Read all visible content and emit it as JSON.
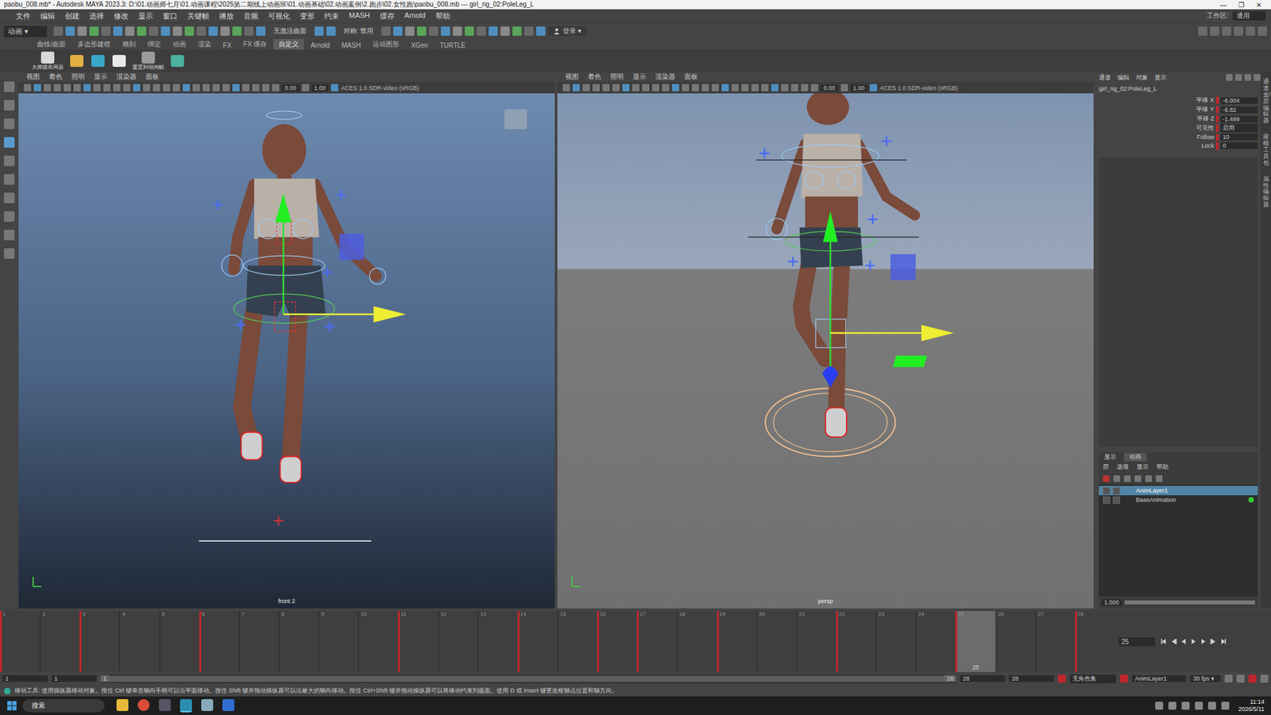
{
  "window": {
    "title": "paobu_008.mb* - Autodesk MAYA 2023.3: D:\\01.动画师七月\\01.动画课程\\2025第二期线上动画班\\01.动画基础\\02.动画案例\\2.跑步\\02.女性跑\\paobu_008.mb  ---  girl_rig_02:PoleLeg_L",
    "controls": [
      "—",
      "❐",
      "✕"
    ]
  },
  "menu": [
    "文件",
    "编辑",
    "创建",
    "选择",
    "修改",
    "显示",
    "窗口",
    "关键帧",
    "播放",
    "音频",
    "可视化",
    "变形",
    "约束",
    "MASH",
    "缓存",
    "Arnold",
    "帮助"
  ],
  "workspace": {
    "label": "工作区:",
    "value": "通用"
  },
  "status_line": {
    "mode": "动画",
    "live_surface": "无激活曲面",
    "symmetry": "对称: 禁用",
    "login": "登录"
  },
  "shelf_tabs": [
    {
      "label": "曲线/曲面",
      "selected": false
    },
    {
      "label": "多边形建模",
      "selected": false
    },
    {
      "label": "雕刻",
      "selected": false
    },
    {
      "label": "绑定",
      "selected": false
    },
    {
      "label": "动画",
      "selected": false
    },
    {
      "label": "渲染",
      "selected": false
    },
    {
      "label": "FX",
      "selected": false
    },
    {
      "label": "FX 缓存",
      "selected": false
    },
    {
      "label": "自定义",
      "selected": true
    },
    {
      "label": "Arnold",
      "selected": false
    },
    {
      "label": "MASH",
      "selected": false
    },
    {
      "label": "运动图形",
      "selected": false
    },
    {
      "label": "XGen",
      "selected": false
    },
    {
      "label": "TURTLE",
      "selected": false
    }
  ],
  "shelf_buttons": [
    {
      "label": "大师级布局器",
      "color": "#d8d8d8"
    },
    {
      "label": "",
      "color": "#e0b040"
    },
    {
      "label": "",
      "color": "#3aa6c8"
    },
    {
      "label": "",
      "color": "#e8e8e8"
    },
    {
      "label": "重置到动画帧",
      "color": "#9a9a9a"
    },
    {
      "label": "",
      "color": "#4bb0a0"
    }
  ],
  "viewports": [
    {
      "menu": [
        "视图",
        "着色",
        "照明",
        "显示",
        "渲染器",
        "面板"
      ],
      "exposure": "0.00",
      "gamma": "1.00",
      "color_space": "ACES 1.0 SDR-video (sRGB)",
      "camera": "front 2",
      "kind": "front"
    },
    {
      "menu": [
        "视图",
        "着色",
        "照明",
        "显示",
        "渲染器",
        "面板"
      ],
      "exposure": "0.00",
      "gamma": "1.00",
      "color_space": "ACES 1.0 SDR-video (sRGB)",
      "camera": "persp",
      "kind": "persp"
    }
  ],
  "channel_box": {
    "menu": [
      "通道",
      "编辑",
      "对象",
      "显示"
    ],
    "node": "girl_rig_02:PoleLeg_L",
    "attributes": [
      {
        "name": "平移 X",
        "value": "-6.004",
        "keyed": true
      },
      {
        "name": "平移 Y",
        "value": "-6.82",
        "keyed": true
      },
      {
        "name": "平移 Z",
        "value": "-1.499",
        "keyed": true
      },
      {
        "name": "可见性",
        "value": "启用",
        "keyed": true
      },
      {
        "name": "Follow",
        "value": "10",
        "keyed": true
      },
      {
        "name": "Lock",
        "value": "0",
        "keyed": true
      }
    ]
  },
  "layer_editor": {
    "tabs": [
      {
        "label": "显示",
        "selected": false
      },
      {
        "label": "动画",
        "selected": true
      }
    ],
    "menu": [
      "层",
      "选项",
      "显示",
      "帮助"
    ],
    "layers": [
      {
        "name": "AnimLayer1",
        "selected": true,
        "active": false
      },
      {
        "name": "BaseAnimation",
        "selected": false,
        "active": true
      }
    ],
    "weight": "1.000"
  },
  "side_tabs": [
    "通道盒/层编辑器",
    "建模工具包",
    "属性编辑器"
  ],
  "timeline": {
    "frames": [
      "1",
      "2",
      "3",
      "4",
      "5",
      "6",
      "7",
      "8",
      "9",
      "10",
      "11",
      "12",
      "13",
      "14",
      "15",
      "16",
      "17",
      "18",
      "19",
      "20",
      "21",
      "22",
      "23",
      "24",
      "25",
      "26",
      "27",
      "28"
    ],
    "keys": [
      1,
      3,
      6,
      11,
      14,
      16,
      17,
      19,
      22,
      25,
      28
    ],
    "current": "25",
    "current_field": "25"
  },
  "range": {
    "start": "1",
    "inner_start": "1",
    "handle_start": "1",
    "handle_end": "28",
    "inner_end": "28",
    "end": "28",
    "character_set": "无角色集",
    "anim_layer": "AnimLayer1",
    "fps": "30 fps"
  },
  "help_line": "移动工具: 使用操纵器移动对象。按住 Ctrl 键单击轴向手柄可以沿平面移动。按住 Shift 键并拖动操纵器可以沿最大的轴向移动。按住 Ctrl+Shift 键并拖动操纵器可以将移动约束到曲面。使用 D 或 Insert 键更改枢轴点位置和轴方向。",
  "taskbar": {
    "search": "搜索",
    "time": "11:14",
    "date": "2026/5/11"
  }
}
